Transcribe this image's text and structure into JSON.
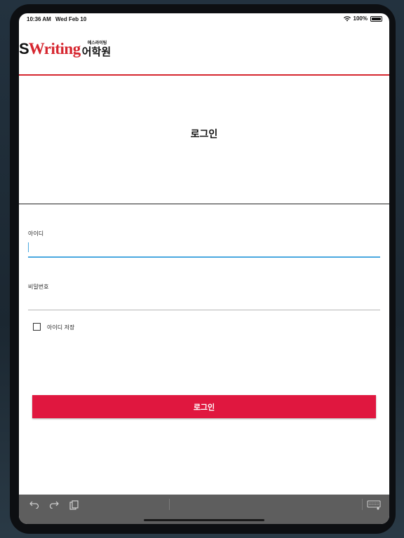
{
  "status_bar": {
    "time": "10:36 AM",
    "date": "Wed Feb 10",
    "battery": "100%"
  },
  "logo": {
    "prefix": "S",
    "brand": "Writing",
    "small_text": "에스라이팅",
    "korean": "어학원"
  },
  "page": {
    "title": "로그인"
  },
  "form": {
    "id_label": "아이디",
    "id_value": "",
    "password_label": "비밀번호",
    "password_value": "",
    "remember_label": "아이디 저장",
    "remember_checked": false,
    "submit_label": "로그인"
  },
  "keyboard_bar": {
    "undo_icon": "undo-icon",
    "redo_icon": "redo-icon",
    "paste_icon": "clipboard-icon",
    "keyboard_icon": "keyboard-icon"
  },
  "colors": {
    "brand_red": "#d6262f",
    "button_red": "#e0173f",
    "focus_blue": "#4aa8e0"
  }
}
